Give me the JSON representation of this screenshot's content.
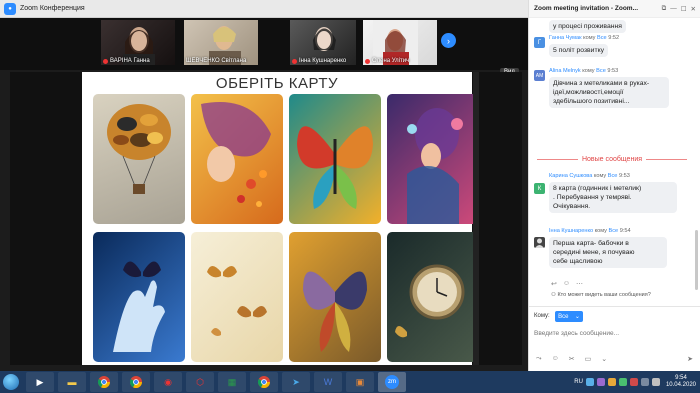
{
  "window": {
    "title": "Zoom Конференция"
  },
  "participants": [
    {
      "name": "ВАРІНА Ганна"
    },
    {
      "name": "ШЕВЧЕНКО Світлана"
    },
    {
      "name": "Інна Кушнаренко"
    },
    {
      "name": "Олена Улітич"
    }
  ],
  "view_button": "Вид",
  "slide": {
    "heading": "ОБЕРІТЬ КАРТУ"
  },
  "chat": {
    "title": "Zoom meeting invitation - Zoom...",
    "partial_top": "у процесі проживання",
    "messages": [
      {
        "avatar": "Г",
        "avatar_color": "#4a90e2",
        "sender": "Ганна Чумак",
        "to": "кому",
        "target": "Все",
        "time": "9:52",
        "text": "5 політ розвитку"
      },
      {
        "avatar": "AM",
        "avatar_color": "#5b7fd1",
        "sender": "Alina Melnyk",
        "to": "кому",
        "target": "Все",
        "time": "9:53",
        "text": "Дівчина з метеликами в руках-\nідеї,можливості,емоції\nздебільшого позитивні..."
      },
      {
        "avatar": "К",
        "avatar_color": "#3cb371",
        "sender": "Карина Сушкова",
        "to": "кому",
        "target": "Все",
        "time": "9:53",
        "text": "8 карта (годинник і метелик)\n. Перебування у темряві.\nОчікування."
      },
      {
        "avatar": "",
        "avatar_color": "#444444",
        "sender": "Інна Кушнаренко",
        "to": "кому",
        "target": "Все",
        "time": "9:54",
        "text": "Перша карта- бабочки в\nсередині мене, я почуваю\nсебе щасливою"
      }
    ],
    "new_messages": "Новые сообщения",
    "who_sees": "Кто может видеть ваши сообщения?",
    "to_label": "Кому:",
    "to_value": "Все",
    "input_placeholder": "Введите здесь сообщение..."
  },
  "taskbar": {
    "lang": "RU",
    "time": "9:54",
    "date": "10.04.2020",
    "zoom_label": "zm"
  }
}
